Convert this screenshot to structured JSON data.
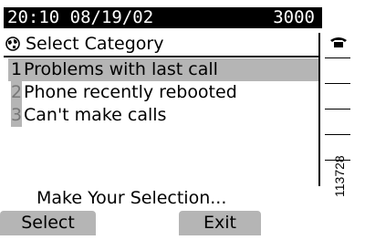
{
  "status_bar": {
    "datetime": "20:10 08/19/02",
    "extension": "3000"
  },
  "header": {
    "title": "Select Category",
    "icon": "globe-icon"
  },
  "line_bar": {
    "icon": "phone-icon"
  },
  "categories": [
    {
      "num": "1",
      "label": "Problems with last call",
      "selected": true
    },
    {
      "num": "2",
      "label": "Phone recently rebooted",
      "selected": false
    },
    {
      "num": "3",
      "label": "Can't make calls",
      "selected": false
    }
  ],
  "prompt": "Make Your Selection...",
  "softkeys": {
    "select": "Select",
    "exit": "Exit"
  },
  "figure_number": "113728",
  "colors": {
    "highlight": "#b5b5b5",
    "status_bar": "#000000"
  }
}
